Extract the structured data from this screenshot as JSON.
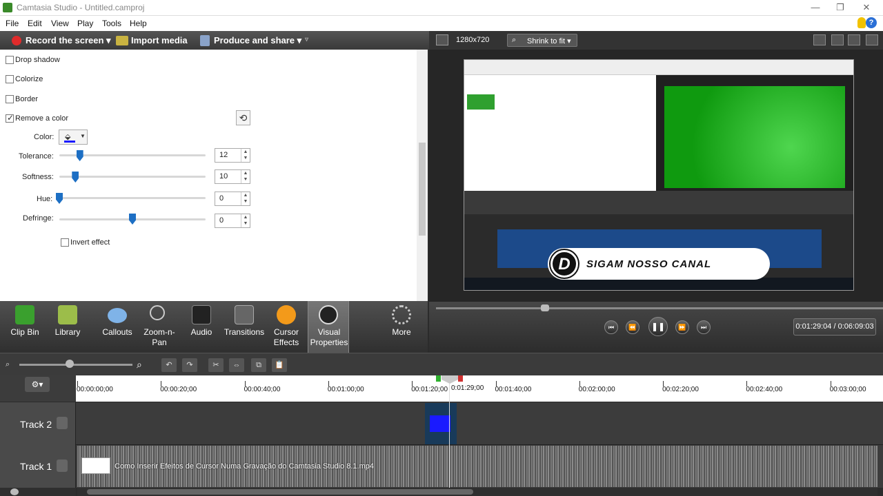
{
  "window": {
    "title": "Camtasia Studio - Untitled.camproj",
    "controls": {
      "minimize": "—",
      "maximize": "❐",
      "close": "✕"
    }
  },
  "menu": [
    "File",
    "Edit",
    "View",
    "Play",
    "Tools",
    "Help"
  ],
  "toolbar": {
    "record": "Record the screen ▾",
    "import": "Import media",
    "produce": "Produce and share ▾",
    "overflow": "▿"
  },
  "visual_properties": {
    "drop_shadow": {
      "label": "Drop shadow",
      "checked": false
    },
    "colorize": {
      "label": "Colorize",
      "checked": false
    },
    "border": {
      "label": "Border",
      "checked": false
    },
    "remove_color": {
      "label": "Remove a color",
      "checked": true
    },
    "color_label": "Color:",
    "sliders": [
      {
        "label": "Tolerance:",
        "value": "12",
        "fraction": 0.14
      },
      {
        "label": "Softness:",
        "value": "10",
        "fraction": 0.11
      },
      {
        "label": "Hue:",
        "value": "0",
        "fraction": 0.0
      },
      {
        "label": "Defringe:",
        "value": "0",
        "fraction": 0.5
      }
    ],
    "invert_effect": {
      "label": "Invert effect",
      "checked": false
    }
  },
  "tabs": [
    {
      "name": "clip-bin",
      "line1": "Clip Bin",
      "line2": ""
    },
    {
      "name": "library",
      "line1": "Library",
      "line2": ""
    },
    {
      "name": "callouts",
      "line1": "Callouts",
      "line2": ""
    },
    {
      "name": "zoom-n-pan",
      "line1": "Zoom-n-",
      "line2": "Pan"
    },
    {
      "name": "audio",
      "line1": "Audio",
      "line2": ""
    },
    {
      "name": "transitions",
      "line1": "Transitions",
      "line2": ""
    },
    {
      "name": "cursor-effects",
      "line1": "Cursor",
      "line2": "Effects"
    },
    {
      "name": "visual-properties",
      "line1": "Visual",
      "line2": "Properties"
    },
    {
      "name": "more",
      "line1": "More",
      "line2": ""
    }
  ],
  "preview": {
    "dimensions": "1280x720",
    "fit": "Shrink to fit ▾",
    "banner_text": "SIGAM NOSSO CANAL",
    "banner_logo": "D",
    "time": "0:01:29:04 / 0:06:09:03",
    "seek_fraction": 0.25
  },
  "timeline": {
    "ticks": [
      "00:00:00;00",
      "00:00:20;00",
      "00:00:40;00",
      "00:01:00;00",
      "00:01:20;00",
      "00:01:40;00",
      "00:02:00;00",
      "00:02:20;00",
      "00:02:40;00",
      "00:03:00;00"
    ],
    "playhead": "0:01:29;00",
    "tracks": [
      {
        "label": "Track 2"
      },
      {
        "label": "Track 1",
        "clip_name": "Como Inserir  Efeitos de Cursor Numa Gravação do Camtasia Studio 8.1.mp4"
      }
    ]
  },
  "colors": {
    "accent": "#1d6fc4",
    "record": "#e02b2b",
    "clip_blue": "#1a1aff"
  }
}
